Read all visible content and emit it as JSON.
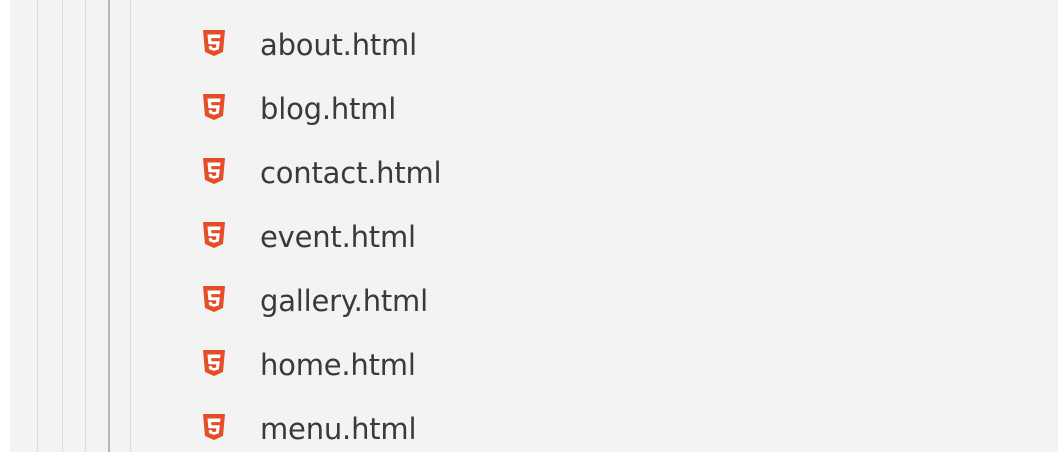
{
  "explorer": {
    "files": [
      {
        "name": "about.html",
        "icon": "html5-icon"
      },
      {
        "name": "blog.html",
        "icon": "html5-icon"
      },
      {
        "name": "contact.html",
        "icon": "html5-icon"
      },
      {
        "name": "event.html",
        "icon": "html5-icon"
      },
      {
        "name": "gallery.html",
        "icon": "html5-icon"
      },
      {
        "name": "home.html",
        "icon": "html5-icon"
      },
      {
        "name": "menu.html",
        "icon": "html5-icon"
      }
    ]
  },
  "colors": {
    "background": "#f3f3f3",
    "text": "#3a3a3a",
    "html_icon": "#e44d26",
    "indent_guide": "#dcdcdc",
    "active_guide": "#b5b5b5"
  }
}
